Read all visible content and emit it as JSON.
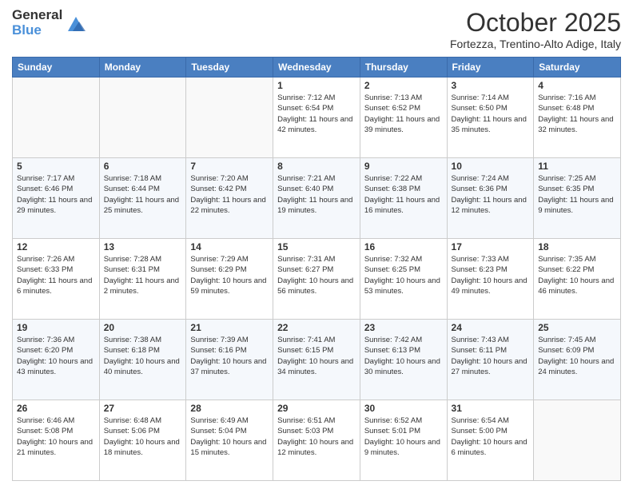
{
  "logo": {
    "general": "General",
    "blue": "Blue"
  },
  "header": {
    "month": "October 2025",
    "location": "Fortezza, Trentino-Alto Adige, Italy"
  },
  "weekdays": [
    "Sunday",
    "Monday",
    "Tuesday",
    "Wednesday",
    "Thursday",
    "Friday",
    "Saturday"
  ],
  "weeks": [
    [
      {
        "day": "",
        "sunrise": "",
        "sunset": "",
        "daylight": ""
      },
      {
        "day": "",
        "sunrise": "",
        "sunset": "",
        "daylight": ""
      },
      {
        "day": "",
        "sunrise": "",
        "sunset": "",
        "daylight": ""
      },
      {
        "day": "1",
        "sunrise": "Sunrise: 7:12 AM",
        "sunset": "Sunset: 6:54 PM",
        "daylight": "Daylight: 11 hours and 42 minutes."
      },
      {
        "day": "2",
        "sunrise": "Sunrise: 7:13 AM",
        "sunset": "Sunset: 6:52 PM",
        "daylight": "Daylight: 11 hours and 39 minutes."
      },
      {
        "day": "3",
        "sunrise": "Sunrise: 7:14 AM",
        "sunset": "Sunset: 6:50 PM",
        "daylight": "Daylight: 11 hours and 35 minutes."
      },
      {
        "day": "4",
        "sunrise": "Sunrise: 7:16 AM",
        "sunset": "Sunset: 6:48 PM",
        "daylight": "Daylight: 11 hours and 32 minutes."
      }
    ],
    [
      {
        "day": "5",
        "sunrise": "Sunrise: 7:17 AM",
        "sunset": "Sunset: 6:46 PM",
        "daylight": "Daylight: 11 hours and 29 minutes."
      },
      {
        "day": "6",
        "sunrise": "Sunrise: 7:18 AM",
        "sunset": "Sunset: 6:44 PM",
        "daylight": "Daylight: 11 hours and 25 minutes."
      },
      {
        "day": "7",
        "sunrise": "Sunrise: 7:20 AM",
        "sunset": "Sunset: 6:42 PM",
        "daylight": "Daylight: 11 hours and 22 minutes."
      },
      {
        "day": "8",
        "sunrise": "Sunrise: 7:21 AM",
        "sunset": "Sunset: 6:40 PM",
        "daylight": "Daylight: 11 hours and 19 minutes."
      },
      {
        "day": "9",
        "sunrise": "Sunrise: 7:22 AM",
        "sunset": "Sunset: 6:38 PM",
        "daylight": "Daylight: 11 hours and 16 minutes."
      },
      {
        "day": "10",
        "sunrise": "Sunrise: 7:24 AM",
        "sunset": "Sunset: 6:36 PM",
        "daylight": "Daylight: 11 hours and 12 minutes."
      },
      {
        "day": "11",
        "sunrise": "Sunrise: 7:25 AM",
        "sunset": "Sunset: 6:35 PM",
        "daylight": "Daylight: 11 hours and 9 minutes."
      }
    ],
    [
      {
        "day": "12",
        "sunrise": "Sunrise: 7:26 AM",
        "sunset": "Sunset: 6:33 PM",
        "daylight": "Daylight: 11 hours and 6 minutes."
      },
      {
        "day": "13",
        "sunrise": "Sunrise: 7:28 AM",
        "sunset": "Sunset: 6:31 PM",
        "daylight": "Daylight: 11 hours and 2 minutes."
      },
      {
        "day": "14",
        "sunrise": "Sunrise: 7:29 AM",
        "sunset": "Sunset: 6:29 PM",
        "daylight": "Daylight: 10 hours and 59 minutes."
      },
      {
        "day": "15",
        "sunrise": "Sunrise: 7:31 AM",
        "sunset": "Sunset: 6:27 PM",
        "daylight": "Daylight: 10 hours and 56 minutes."
      },
      {
        "day": "16",
        "sunrise": "Sunrise: 7:32 AM",
        "sunset": "Sunset: 6:25 PM",
        "daylight": "Daylight: 10 hours and 53 minutes."
      },
      {
        "day": "17",
        "sunrise": "Sunrise: 7:33 AM",
        "sunset": "Sunset: 6:23 PM",
        "daylight": "Daylight: 10 hours and 49 minutes."
      },
      {
        "day": "18",
        "sunrise": "Sunrise: 7:35 AM",
        "sunset": "Sunset: 6:22 PM",
        "daylight": "Daylight: 10 hours and 46 minutes."
      }
    ],
    [
      {
        "day": "19",
        "sunrise": "Sunrise: 7:36 AM",
        "sunset": "Sunset: 6:20 PM",
        "daylight": "Daylight: 10 hours and 43 minutes."
      },
      {
        "day": "20",
        "sunrise": "Sunrise: 7:38 AM",
        "sunset": "Sunset: 6:18 PM",
        "daylight": "Daylight: 10 hours and 40 minutes."
      },
      {
        "day": "21",
        "sunrise": "Sunrise: 7:39 AM",
        "sunset": "Sunset: 6:16 PM",
        "daylight": "Daylight: 10 hours and 37 minutes."
      },
      {
        "day": "22",
        "sunrise": "Sunrise: 7:41 AM",
        "sunset": "Sunset: 6:15 PM",
        "daylight": "Daylight: 10 hours and 34 minutes."
      },
      {
        "day": "23",
        "sunrise": "Sunrise: 7:42 AM",
        "sunset": "Sunset: 6:13 PM",
        "daylight": "Daylight: 10 hours and 30 minutes."
      },
      {
        "day": "24",
        "sunrise": "Sunrise: 7:43 AM",
        "sunset": "Sunset: 6:11 PM",
        "daylight": "Daylight: 10 hours and 27 minutes."
      },
      {
        "day": "25",
        "sunrise": "Sunrise: 7:45 AM",
        "sunset": "Sunset: 6:09 PM",
        "daylight": "Daylight: 10 hours and 24 minutes."
      }
    ],
    [
      {
        "day": "26",
        "sunrise": "Sunrise: 6:46 AM",
        "sunset": "Sunset: 5:08 PM",
        "daylight": "Daylight: 10 hours and 21 minutes."
      },
      {
        "day": "27",
        "sunrise": "Sunrise: 6:48 AM",
        "sunset": "Sunset: 5:06 PM",
        "daylight": "Daylight: 10 hours and 18 minutes."
      },
      {
        "day": "28",
        "sunrise": "Sunrise: 6:49 AM",
        "sunset": "Sunset: 5:04 PM",
        "daylight": "Daylight: 10 hours and 15 minutes."
      },
      {
        "day": "29",
        "sunrise": "Sunrise: 6:51 AM",
        "sunset": "Sunset: 5:03 PM",
        "daylight": "Daylight: 10 hours and 12 minutes."
      },
      {
        "day": "30",
        "sunrise": "Sunrise: 6:52 AM",
        "sunset": "Sunset: 5:01 PM",
        "daylight": "Daylight: 10 hours and 9 minutes."
      },
      {
        "day": "31",
        "sunrise": "Sunrise: 6:54 AM",
        "sunset": "Sunset: 5:00 PM",
        "daylight": "Daylight: 10 hours and 6 minutes."
      },
      {
        "day": "",
        "sunrise": "",
        "sunset": "",
        "daylight": ""
      }
    ]
  ]
}
